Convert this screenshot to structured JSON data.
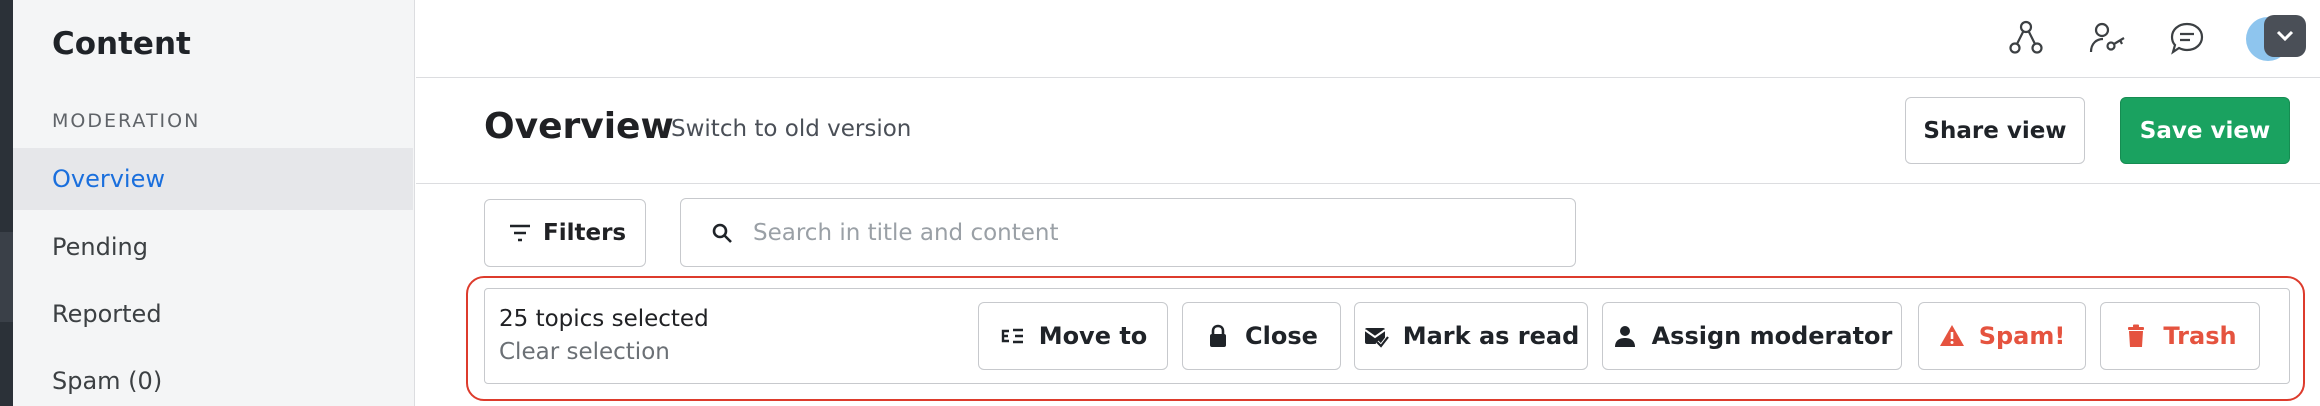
{
  "sidebar": {
    "title": "Content",
    "section": "MODERATION",
    "items": [
      {
        "label": "Overview",
        "active": true
      },
      {
        "label": "Pending"
      },
      {
        "label": "Reported"
      },
      {
        "label": "Spam (0)"
      }
    ]
  },
  "topbar": {
    "icons": [
      "people-network-icon",
      "user-key-icon",
      "chat-bubble-icon",
      "avatar",
      "chevron-down-icon"
    ]
  },
  "header": {
    "title": "Overview",
    "old_version_link": "Switch to old version",
    "share_label": "Share view",
    "save_label": "Save view"
  },
  "toolbar": {
    "filters_label": "Filters",
    "search_placeholder": "Search in title and content"
  },
  "bulk": {
    "count_label": "25 topics selected",
    "clear_label": "Clear selection",
    "actions": [
      {
        "label": "Move to",
        "icon": "move-list-icon"
      },
      {
        "label": "Close",
        "icon": "lock-icon"
      },
      {
        "label": "Mark as read",
        "icon": "mail-check-icon"
      },
      {
        "label": "Assign moderator",
        "icon": "person-icon"
      },
      {
        "label": "Spam!",
        "icon": "warning-icon",
        "danger": true
      },
      {
        "label": "Trash",
        "icon": "trash-icon",
        "danger": true
      }
    ]
  },
  "colors": {
    "accent": "#1a6fdd",
    "save_green": "#1aa260",
    "danger": "#e5533f",
    "highlight": "#dd3b2c"
  }
}
